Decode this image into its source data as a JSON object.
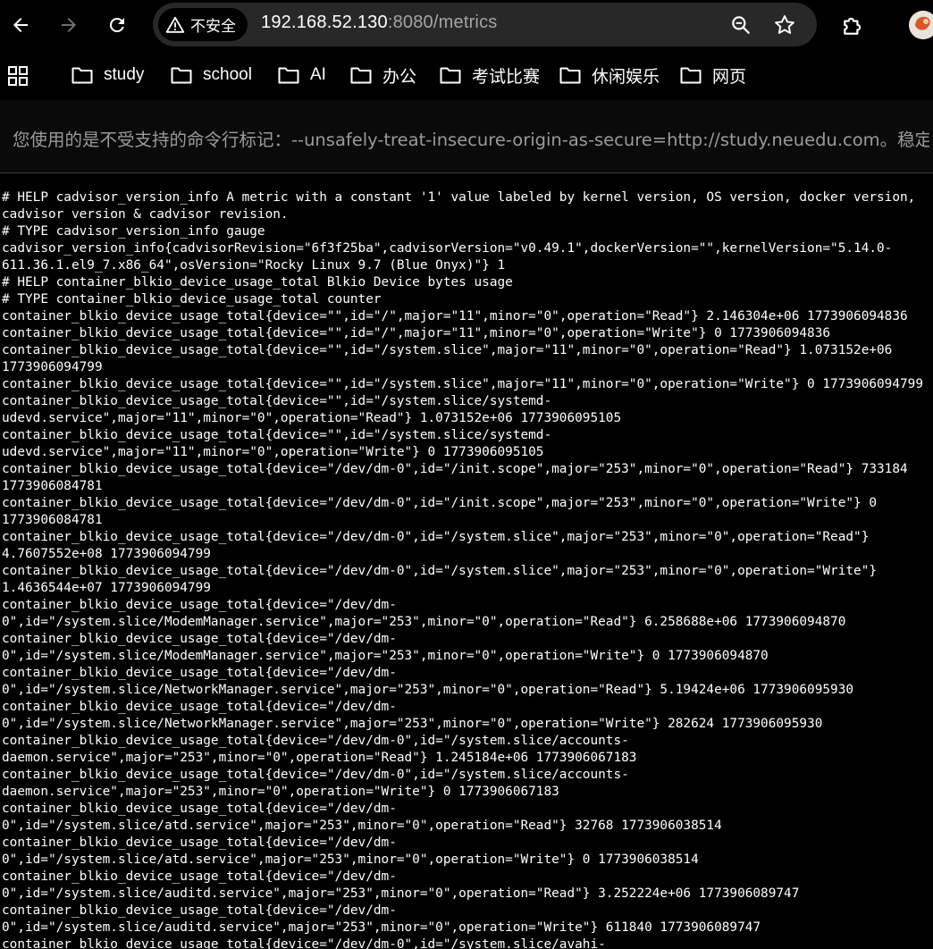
{
  "toolbar": {
    "back_icon": "arrow-left-icon",
    "forward_icon": "arrow-right-icon",
    "reload_icon": "reload-icon",
    "security_chip_label": "不安全",
    "url_host": "192.168.52.130",
    "url_rest": ":8080/metrics",
    "zoom_icon": "zoom-icon",
    "bookmark_star_icon": "star-icon",
    "extensions_icon": "puzzle-icon",
    "profile_icon": "avatar"
  },
  "bookmarks": {
    "items": [
      {
        "label": "study"
      },
      {
        "label": "school"
      },
      {
        "label": "AI"
      },
      {
        "label": "办公"
      },
      {
        "label": "考试比赛"
      },
      {
        "label": "休闲娱乐"
      },
      {
        "label": "网页"
      }
    ]
  },
  "infobar": {
    "message": "您使用的是不受支持的命令行标记：--unsafely-treat-insecure-origin-as-secure=http://study.neuedu.com。稳定..."
  },
  "page": {
    "lines": [
      "# HELP cadvisor_version_info A metric with a constant '1' value labeled by kernel version, OS version, docker version,",
      "cadvisor version & cadvisor revision.",
      "# TYPE cadvisor_version_info gauge",
      "cadvisor_version_info{cadvisorRevision=\"6f3f25ba\",cadvisorVersion=\"v0.49.1\",dockerVersion=\"\",kernelVersion=\"5.14.0-",
      "611.36.1.el9_7.x86_64\",osVersion=\"Rocky Linux 9.7 (Blue Onyx)\"} 1",
      "# HELP container_blkio_device_usage_total Blkio Device bytes usage",
      "# TYPE container_blkio_device_usage_total counter",
      "container_blkio_device_usage_total{device=\"\",id=\"/\",major=\"11\",minor=\"0\",operation=\"Read\"} 2.146304e+06 1773906094836",
      "container_blkio_device_usage_total{device=\"\",id=\"/\",major=\"11\",minor=\"0\",operation=\"Write\"} 0 1773906094836",
      "container_blkio_device_usage_total{device=\"\",id=\"/system.slice\",major=\"11\",minor=\"0\",operation=\"Read\"} 1.073152e+06",
      "1773906094799",
      "container_blkio_device_usage_total{device=\"\",id=\"/system.slice\",major=\"11\",minor=\"0\",operation=\"Write\"} 0 1773906094799",
      "container_blkio_device_usage_total{device=\"\",id=\"/system.slice/systemd-",
      "udevd.service\",major=\"11\",minor=\"0\",operation=\"Read\"} 1.073152e+06 1773906095105",
      "container_blkio_device_usage_total{device=\"\",id=\"/system.slice/systemd-",
      "udevd.service\",major=\"11\",minor=\"0\",operation=\"Write\"} 0 1773906095105",
      "container_blkio_device_usage_total{device=\"/dev/dm-0\",id=\"/init.scope\",major=\"253\",minor=\"0\",operation=\"Read\"} 733184",
      "1773906084781",
      "container_blkio_device_usage_total{device=\"/dev/dm-0\",id=\"/init.scope\",major=\"253\",minor=\"0\",operation=\"Write\"} 0",
      "1773906084781",
      "container_blkio_device_usage_total{device=\"/dev/dm-0\",id=\"/system.slice\",major=\"253\",minor=\"0\",operation=\"Read\"}",
      "4.7607552e+08 1773906094799",
      "container_blkio_device_usage_total{device=\"/dev/dm-0\",id=\"/system.slice\",major=\"253\",minor=\"0\",operation=\"Write\"}",
      "1.4636544e+07 1773906094799",
      "container_blkio_device_usage_total{device=\"/dev/dm-",
      "0\",id=\"/system.slice/ModemManager.service\",major=\"253\",minor=\"0\",operation=\"Read\"} 6.258688e+06 1773906094870",
      "container_blkio_device_usage_total{device=\"/dev/dm-",
      "0\",id=\"/system.slice/ModemManager.service\",major=\"253\",minor=\"0\",operation=\"Write\"} 0 1773906094870",
      "container_blkio_device_usage_total{device=\"/dev/dm-",
      "0\",id=\"/system.slice/NetworkManager.service\",major=\"253\",minor=\"0\",operation=\"Read\"} 5.19424e+06 1773906095930",
      "container_blkio_device_usage_total{device=\"/dev/dm-",
      "0\",id=\"/system.slice/NetworkManager.service\",major=\"253\",minor=\"0\",operation=\"Write\"} 282624 1773906095930",
      "container_blkio_device_usage_total{device=\"/dev/dm-0\",id=\"/system.slice/accounts-",
      "daemon.service\",major=\"253\",minor=\"0\",operation=\"Read\"} 1.245184e+06 1773906067183",
      "container_blkio_device_usage_total{device=\"/dev/dm-0\",id=\"/system.slice/accounts-",
      "daemon.service\",major=\"253\",minor=\"0\",operation=\"Write\"} 0 1773906067183",
      "container_blkio_device_usage_total{device=\"/dev/dm-",
      "0\",id=\"/system.slice/atd.service\",major=\"253\",minor=\"0\",operation=\"Read\"} 32768 1773906038514",
      "container_blkio_device_usage_total{device=\"/dev/dm-",
      "0\",id=\"/system.slice/atd.service\",major=\"253\",minor=\"0\",operation=\"Write\"} 0 1773906038514",
      "container_blkio_device_usage_total{device=\"/dev/dm-",
      "0\",id=\"/system.slice/auditd.service\",major=\"253\",minor=\"0\",operation=\"Read\"} 3.252224e+06 1773906089747",
      "container_blkio_device_usage_total{device=\"/dev/dm-",
      "0\",id=\"/system.slice/auditd.service\",major=\"253\",minor=\"0\",operation=\"Write\"} 611840 1773906089747",
      "container_blkio_device_usage_total{device=\"/dev/dm-0\",id=\"/system.slice/avahi-"
    ]
  },
  "colors": {
    "background": "#000000",
    "omnibox": "#282828",
    "url_dim": "#a4a4a4",
    "infobar_text": "#9a9a9a",
    "text": "#ffffff"
  }
}
